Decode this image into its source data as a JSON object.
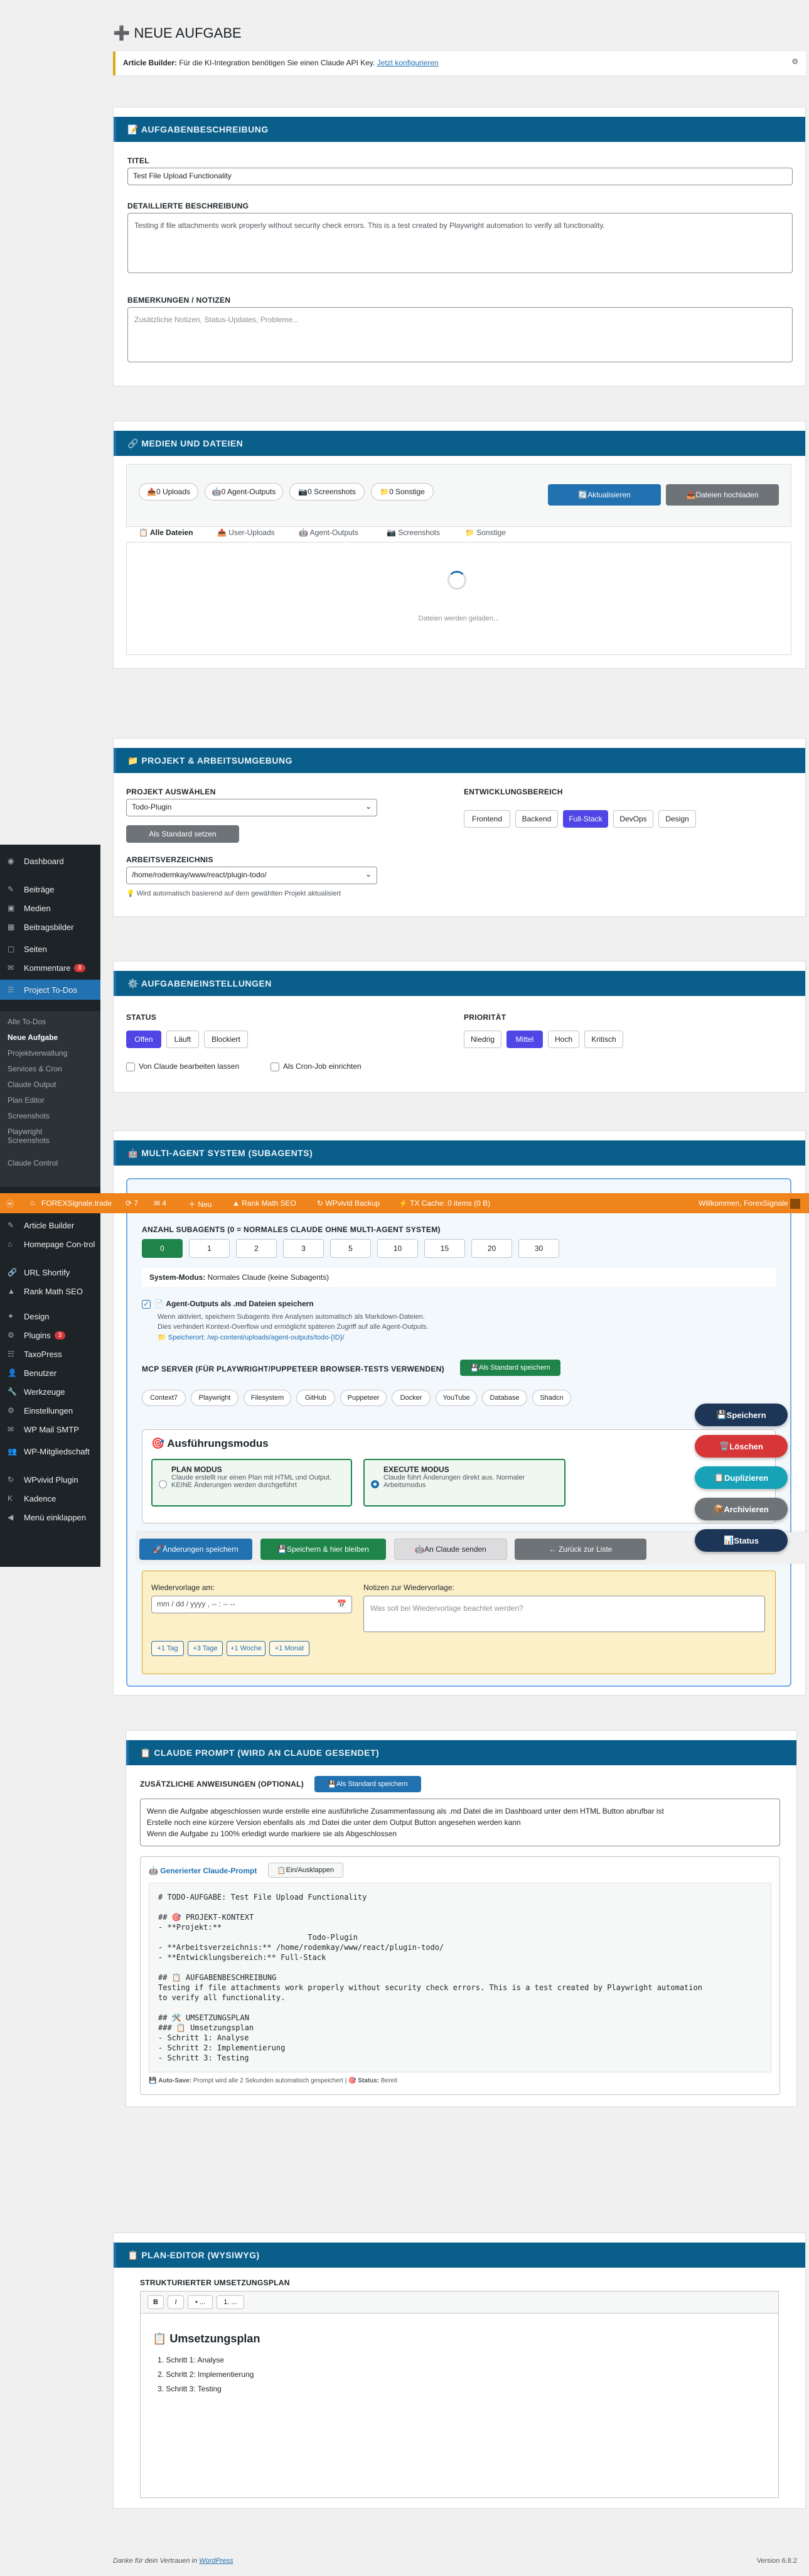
{
  "page": {
    "title": "NEUE AUFGABE",
    "notice_strong": "Article Builder:",
    "notice_text": " Für die KI-Integration benötigen Sie einen Claude API Key.",
    "notice_link": "Jetzt konfigurieren"
  },
  "desc": {
    "header": "AUFGABENBESCHREIBUNG",
    "title_label": "TITEL",
    "title_value": "Test File Upload Functionality",
    "detail_label": "DETAILLIERTE BESCHREIBUNG",
    "detail_value": "Testing if file attachments work properly without security check errors. This is a test created by Playwright automation to verify all functionality.",
    "notes_label": "BEMERKUNGEN / NOTIZEN",
    "notes_placeholder": "Zusätzliche Notizen, Status-Updates, Probleme..."
  },
  "media": {
    "header": "MEDIEN UND DATEIEN",
    "stats": [
      "0 Uploads",
      "0 Agent-Outputs",
      "0 Screenshots",
      "0 Sonstige"
    ],
    "refresh": "Aktualisieren",
    "upload": "Dateien hochladen",
    "tabs": [
      "Alle Dateien",
      "User-Uploads",
      "Agent-Outputs",
      "Screenshots",
      "Sonstige"
    ],
    "loading": "Dateien werden geladen..."
  },
  "project": {
    "header": "PROJEKT & ARBEITSUMGEBUNG",
    "select_label": "PROJEKT AUSWÄHLEN",
    "select_value": "Todo-Plugin",
    "default_btn": "Als Standard setzen",
    "dir_label": "ARBEITSVERZEICHNIS",
    "dir_value": "/home/rodemkay/www/react/plugin-todo/",
    "dir_hint": "Wird automatisch basierend auf dem gewählten Projekt aktualisiert",
    "area_label": "ENTWICKLUNGSBEREICH",
    "areas": [
      "Frontend",
      "Backend",
      "Full-Stack",
      "DevOps",
      "Design"
    ]
  },
  "settings": {
    "header": "AUFGABENEINSTELLUNGEN",
    "status_label": "STATUS",
    "statuses": [
      "Offen",
      "Läuft",
      "Blockiert"
    ],
    "prio_label": "PRIORITÄT",
    "prios": [
      "Niedrig",
      "Mittel",
      "Hoch",
      "Kritisch"
    ],
    "cb1": "Von Claude bearbeiten lassen",
    "cb2": "Als Cron-Job einrichten"
  },
  "agent": {
    "header": "MULTI-AGENT SYSTEM (SUBAGENTS)",
    "count_label": "ANZAHL SUBAGENTS (0 = NORMALES CLAUDE OHNE MULTI-AGENT SYSTEM)",
    "counts": [
      "0",
      "1",
      "2",
      "3",
      "5",
      "10",
      "15",
      "20",
      "30"
    ],
    "mode_strong": "System-Modus:",
    "mode_text": " Normales Claude (keine Subagents)",
    "outputs_label": "Agent-Outputs als .md Dateien speichern",
    "outputs_line1": "Wenn aktiviert, speichern Subagents ihre Analysen automatisch als Markdown-Dateien.",
    "outputs_line2": "Dies verhindert Kontext-Overflow und ermöglicht späteren Zugriff auf alle Agent-Outputs.",
    "outputs_path": "Speicherort: /wp-content/uploads/agent-outputs/todo-{ID}/",
    "mcp_label": "MCP SERVER (FÜR PLAYWRIGHT/PUPPETEER BROWSER-TESTS VERWENDEN)",
    "mcp_default": "Als Standard speichern",
    "mcp": [
      "Context7",
      "Playwright",
      "Filesystem",
      "GitHub",
      "Puppeteer",
      "Docker",
      "YouTube",
      "Database",
      "Shadcn"
    ],
    "exec_title": "Ausführungsmodus",
    "plan_title": "PLAN MODUS",
    "plan_text": "Claude erstellt nur einen Plan mit HTML und Output. KEINE Änderungen werden durchgeführt",
    "exec_mode_title": "EXECUTE MODUS",
    "exec_mode_text": "Claude führt Änderungen direkt aus. Normaler Arbeitsmodus"
  },
  "actions": {
    "save": "Änderungen speichern",
    "save_stay": "Speichern & hier bleiben",
    "send": "An Claude senden",
    "back": "← Zurück zur Liste"
  },
  "resume": {
    "date_label": "Wiedervorlage am:",
    "date_value": "mm / dd / yyyy , -- : -- --",
    "note_label": "Notizen zur Wiedervorlage:",
    "note_placeholder": "Was soll bei Wiedervorlage beachtet werden?",
    "quick": [
      "+1 Tag",
      "+3 Tage",
      "+1 Woche",
      "+1 Monat"
    ]
  },
  "prompt": {
    "header": "CLAUDE PROMPT (WIRD AN CLAUDE GESENDET)",
    "add_label": "ZUSÄTZLICHE ANWEISUNGEN (OPTIONAL)",
    "add_default": "Als Standard speichern",
    "add_text": "Wenn die Aufgabe abgeschlossen wurde erstelle eine ausführliche Zusammenfassung als .md Datei die im Dashboard unter dem HTML Button abrufbar ist\nErstelle noch eine kürzere Version ebenfalls als .md Datei die unter dem Output Button angesehen werden kann\nWenn die Aufgabe zu 100% erledigt wurde markiere sie als Abgeschlossen",
    "gen_label": "Generierter Claude-Prompt",
    "toggle": "Ein/Ausklappen",
    "code": "# TODO-AUFGABE: Test File Upload Functionality\n\n## 🎯 PROJEKT-KONTEXT\n- **Projekt:**\n                                 Todo-Plugin\n- **Arbeitsverzeichnis:** /home/rodemkay/www/react/plugin-todo/\n- **Entwicklungsbereich:** Full-Stack\n\n## 📋 AUFGABENBESCHREIBUNG\nTesting if file attachments work properly without security check errors. This is a test created by Playwright automation\nto verify all functionality.\n\n## 🛠️ UMSETZUNGSPLAN\n### 📋 Umsetzungsplan\n- Schritt 1: Analyse\n- Schritt 2: Implementierung\n- Schritt 3: Testing",
    "autosave_strong": "Auto-Save:",
    "autosave_text": " Prompt wird alle 2 Sekunden automatisch gespeichert |",
    "status_strong": "Status:",
    "status_text": " Bereit"
  },
  "plan": {
    "header": "PLAN-EDITOR (WYSIWYG)",
    "label": "STRUKTURIERTER UMSETZUNGSPLAN",
    "tools": [
      "B",
      "I",
      "• ...",
      "1. ..."
    ],
    "title": "Umsetzungsplan",
    "steps": [
      "Schritt 1: Analyse",
      "Schritt 2: Implementierung",
      "Schritt 3: Testing"
    ]
  },
  "footer": {
    "thanks": "Danke für dein Vertrauen in ",
    "wp": "WordPress",
    "version": "Version 6.8.2"
  },
  "adminbar": {
    "site": "FOREXSignale.trade",
    "comments": "7",
    "updates": "4",
    "new": "Neu",
    "rankmath": "Rank Math SEO",
    "backup": "WPvivid Backup",
    "cache": "TX Cache: 0 items (0 B)",
    "hello": "Willkommen, ForexSignale"
  },
  "fabs": [
    "Speichern",
    "Löschen",
    "Duplizieren",
    "Archivieren",
    "Status"
  ],
  "sidebar": {
    "top": [
      {
        "icon": "◉",
        "label": "Dashboard"
      },
      {
        "icon": "✎",
        "label": "Beiträge"
      },
      {
        "icon": "▣",
        "label": "Medien"
      },
      {
        "icon": "▦",
        "label": "Beitragsbilder"
      },
      {
        "icon": "▢",
        "label": "Seiten"
      },
      {
        "icon": "✉",
        "label": "Kommentare",
        "badge": "8"
      },
      {
        "icon": "☰",
        "label": "Project To-Dos"
      }
    ],
    "sub": [
      "Alle To-Dos",
      "Neue Aufgabe",
      "Projektverwaltung",
      "Services & Cron",
      "Claude Output",
      "Plan Editor",
      "Screenshots",
      "Playwright Screenshots",
      "Claude Control"
    ],
    "bottom": [
      {
        "icon": "✎",
        "label": "Article Builder"
      },
      {
        "icon": "⌂",
        "label": "Homepage Con-trol"
      },
      {
        "icon": "🔗",
        "label": "URL Shortify"
      },
      {
        "icon": "▲",
        "label": "Rank Math SEO"
      },
      {
        "icon": "✦",
        "label": "Design"
      },
      {
        "icon": "⚙",
        "label": "Plugins",
        "badge": "3"
      },
      {
        "icon": "☷",
        "label": "TaxoPress"
      },
      {
        "icon": "👤",
        "label": "Benutzer"
      },
      {
        "icon": "🔧",
        "label": "Werkzeuge"
      },
      {
        "icon": "⚙",
        "label": "Einstellungen"
      },
      {
        "icon": "✉",
        "label": "WP Mail SMTP"
      },
      {
        "icon": "👥",
        "label": "WP-Mitgliedschaft"
      },
      {
        "icon": "↻",
        "label": "WPvivid Plugin"
      },
      {
        "icon": "K",
        "label": "Kadence"
      },
      {
        "icon": "◀",
        "label": "Menü einklappen"
      }
    ]
  },
  "colors": {
    "header_blue": "#0a5e8a",
    "admin_orange": "#f0841c",
    "accent": "#4f46e5",
    "green": "#1e8449"
  }
}
